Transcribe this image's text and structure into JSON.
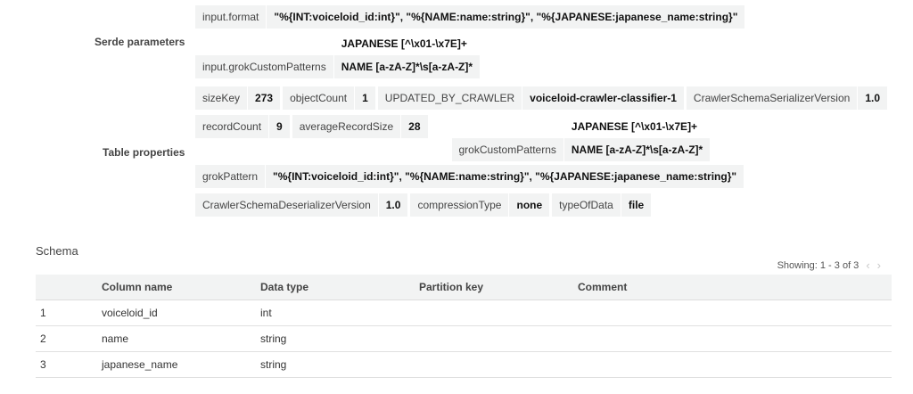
{
  "serde": {
    "label": "Serde parameters",
    "input_format": {
      "key": "input.format",
      "value": "\"%{INT:voiceloid_id:int}\", \"%{NAME:name:string}\", \"%{JAPANESE:japanese_name:string}\""
    },
    "grok_custom": {
      "key": "input.grokCustomPatterns",
      "values": [
        "JAPANESE [^\\x01-\\x7E]+",
        "NAME [a-zA-Z]*\\s[a-zA-Z]*"
      ]
    }
  },
  "table_props": {
    "label": "Table properties",
    "row1": [
      {
        "key": "sizeKey",
        "value": "273"
      },
      {
        "key": "objectCount",
        "value": "1"
      },
      {
        "key": "UPDATED_BY_CRAWLER",
        "value": "voiceloid-crawler-classifier-1"
      },
      {
        "key": "CrawlerSchemaSerializerVersion",
        "value": "1.0"
      }
    ],
    "row2": [
      {
        "key": "recordCount",
        "value": "9"
      },
      {
        "key": "averageRecordSize",
        "value": "28"
      }
    ],
    "grok_custom": {
      "key": "grokCustomPatterns",
      "values": [
        "JAPANESE [^\\x01-\\x7E]+",
        "NAME [a-zA-Z]*\\s[a-zA-Z]*"
      ]
    },
    "grok_pattern": {
      "key": "grokPattern",
      "value": "\"%{INT:voiceloid_id:int}\", \"%{NAME:name:string}\", \"%{JAPANESE:japanese_name:string}\""
    },
    "row4": [
      {
        "key": "CrawlerSchemaDeserializerVersion",
        "value": "1.0"
      },
      {
        "key": "compressionType",
        "value": "none"
      },
      {
        "key": "typeOfData",
        "value": "file"
      }
    ]
  },
  "schema": {
    "title": "Schema",
    "showing": "Showing: 1 - 3 of 3",
    "prev_icon": "chevron-left-icon",
    "next_icon": "chevron-right-icon",
    "columns": [
      "",
      "Column name",
      "Data type",
      "Partition key",
      "Comment"
    ],
    "rows": [
      [
        "1",
        "voiceloid_id",
        "int",
        "",
        ""
      ],
      [
        "2",
        "name",
        "string",
        "",
        ""
      ],
      [
        "3",
        "japanese_name",
        "string",
        "",
        ""
      ]
    ]
  }
}
